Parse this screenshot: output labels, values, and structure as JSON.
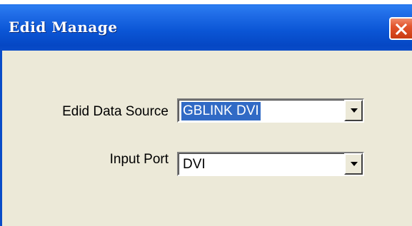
{
  "window": {
    "title": "Edid Manage"
  },
  "form": {
    "edid_source": {
      "label": "Edid Data Source",
      "value": "GBLINK DVI"
    },
    "input_port": {
      "label": "Input Port",
      "value": "DVI"
    }
  },
  "colors": {
    "titlebar": "#0a56d6",
    "window_bg": "#ece9d8",
    "selection": "#316ac5",
    "close_button": "#e2542c"
  },
  "icons": {
    "close": "close-icon",
    "dropdown": "chevron-down-icon"
  }
}
